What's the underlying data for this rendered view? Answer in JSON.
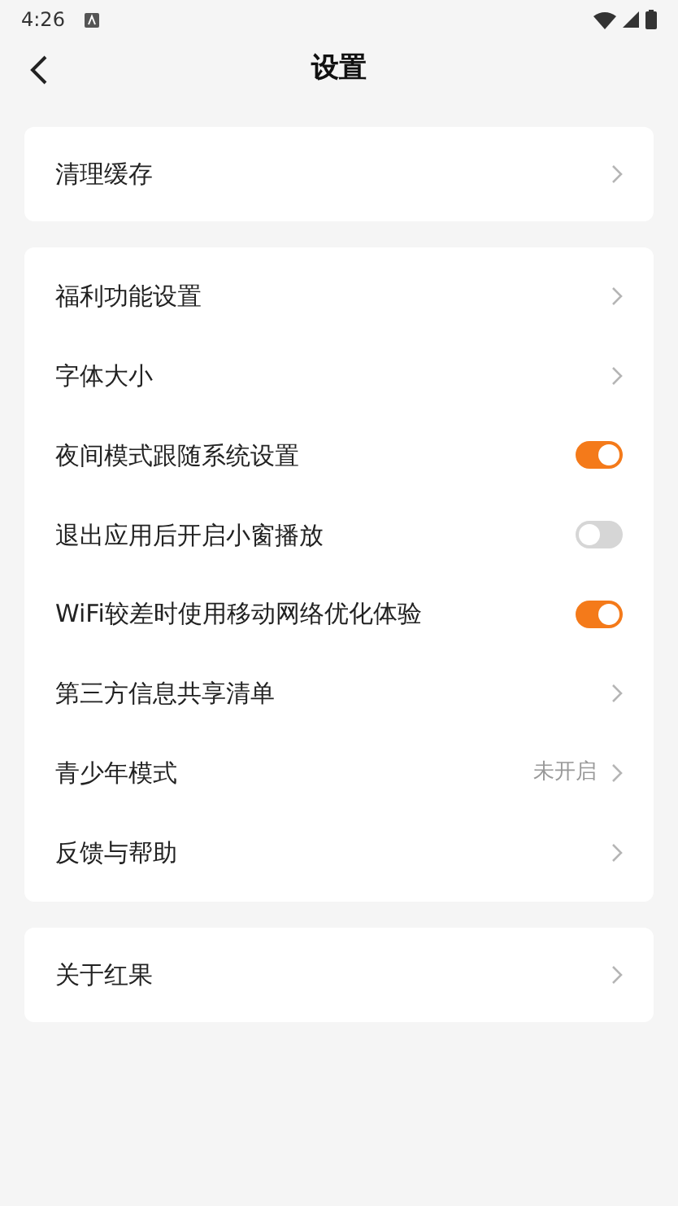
{
  "status_bar": {
    "time": "4:26"
  },
  "header": {
    "title": "设置"
  },
  "groups": [
    {
      "rows": [
        {
          "label": "清理缓存",
          "kind": "link"
        }
      ]
    },
    {
      "rows": [
        {
          "label": "福利功能设置",
          "kind": "link"
        },
        {
          "label": "字体大小",
          "kind": "link"
        },
        {
          "label": "夜间模式跟随系统设置",
          "kind": "toggle",
          "on": true
        },
        {
          "label": "退出应用后开启小窗播放",
          "kind": "toggle",
          "on": false
        },
        {
          "label": "WiFi较差时使用移动网络优化体验",
          "kind": "toggle",
          "on": true
        },
        {
          "label": "第三方信息共享清单",
          "kind": "link"
        },
        {
          "label": "青少年模式",
          "kind": "link",
          "value": "未开启"
        },
        {
          "label": "反馈与帮助",
          "kind": "link"
        }
      ]
    },
    {
      "rows": [
        {
          "label": "关于红果",
          "kind": "link"
        }
      ]
    }
  ]
}
